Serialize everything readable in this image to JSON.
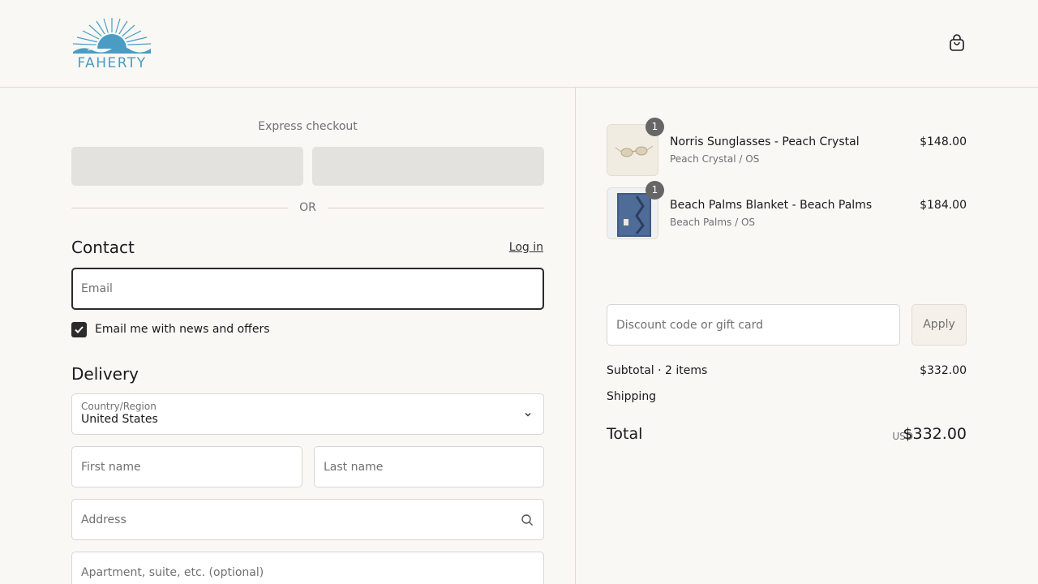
{
  "brand": {
    "name": "FAHERTY",
    "accent": "#4a9cc4"
  },
  "header": {
    "cart_icon": "shopping-bag-icon"
  },
  "express": {
    "title": "Express checkout",
    "divider": "OR"
  },
  "contact": {
    "title": "Contact",
    "login_label": "Log in",
    "email_placeholder": "Email",
    "newsletter_label": "Email me with news and offers",
    "newsletter_checked": true
  },
  "delivery": {
    "title": "Delivery",
    "country_label": "Country/Region",
    "country_value": "United States",
    "first_name_placeholder": "First name",
    "last_name_placeholder": "Last name",
    "address_placeholder": "Address",
    "apartment_placeholder": "Apartment, suite, etc. (optional)"
  },
  "cart": {
    "items": [
      {
        "qty": "1",
        "name": "Norris Sunglasses - Peach Crystal",
        "variant": "Peach Crystal / OS",
        "price": "$148.00"
      },
      {
        "qty": "1",
        "name": "Beach Palms Blanket - Beach Palms",
        "variant": "Beach Palms / OS",
        "price": "$184.00"
      }
    ],
    "discount_placeholder": "Discount code or gift card",
    "apply_label": "Apply",
    "subtotal_label": "Subtotal · 2 items",
    "subtotal_value": "$332.00",
    "shipping_label": "Shipping",
    "total_label": "Total",
    "total_currency": "USD",
    "total_value": "$332.00"
  }
}
